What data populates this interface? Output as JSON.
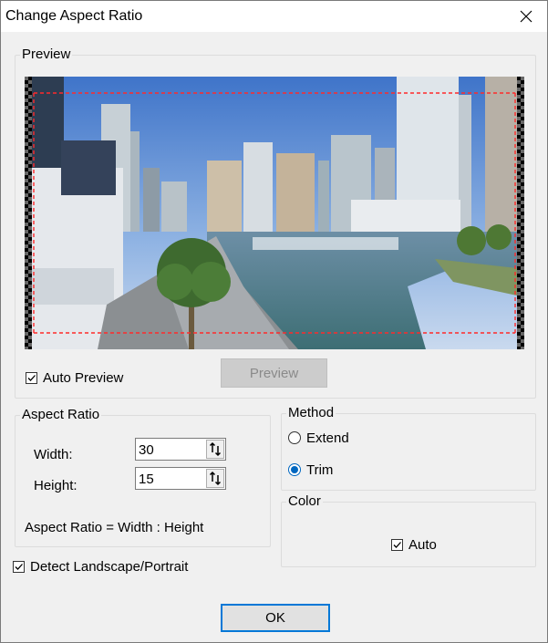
{
  "window": {
    "title": "Change Aspect Ratio",
    "close_icon": "close-icon"
  },
  "preview_group": {
    "label": "Preview",
    "auto_preview": {
      "label": "Auto Preview",
      "checked": true
    },
    "preview_button": {
      "label": "Preview",
      "enabled": false
    }
  },
  "aspect_group": {
    "label": "Aspect Ratio",
    "width_label": "Width:",
    "width_value": "30",
    "height_label": "Height:",
    "height_value": "15",
    "formula": "Aspect Ratio = Width : Height"
  },
  "method_group": {
    "label": "Method",
    "options": [
      {
        "label": "Extend",
        "selected": false
      },
      {
        "label": "Trim",
        "selected": true
      }
    ]
  },
  "color_group": {
    "label": "Color",
    "auto": {
      "label": "Auto",
      "checked": true
    }
  },
  "detect": {
    "label": "Detect Landscape/Portrait",
    "checked": true
  },
  "ok_button": {
    "label": "OK"
  },
  "colors": {
    "accent": "#0078d7",
    "trim_line": "#ff2a2a"
  }
}
